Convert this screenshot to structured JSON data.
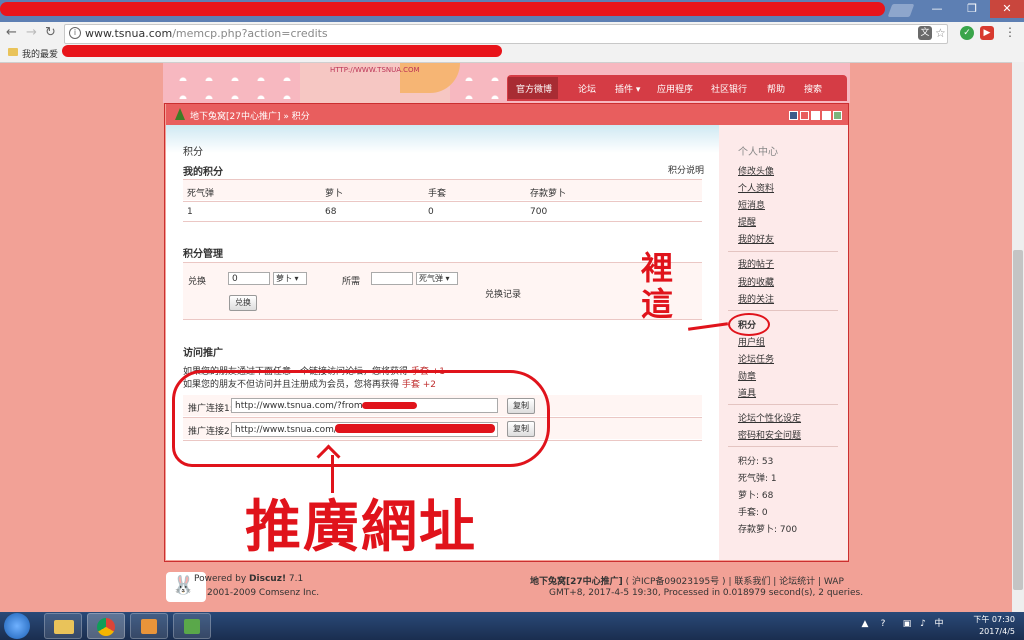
{
  "browser": {
    "url_host": "www.tsnua.com",
    "url_path": "/memcp.php?action=credits",
    "bookmark_folder": "我的最爱"
  },
  "banner": {
    "watermark_url": "HTTP://WWW.TSNUA.COM",
    "nav": [
      "官方微博",
      "论坛",
      "插件",
      "应用程序",
      "社区银行",
      "帮助",
      "搜索"
    ]
  },
  "breadcrumb": "地下兔窝[27中心推广] » 积分",
  "credits": {
    "page_title": "积分",
    "my_credits_heading": "我的积分",
    "explain_link": "积分说明",
    "columns": [
      "死气弹",
      "萝卜",
      "手套",
      "存款萝卜"
    ],
    "values": [
      "1",
      "68",
      "0",
      "700"
    ]
  },
  "manage": {
    "heading": "积分管理",
    "exchange_label": "兑换",
    "exchange_amount": "0",
    "exchange_unit": "萝卜",
    "required_label": "所需",
    "required_amount": "",
    "required_unit": "死气弹",
    "exchange_button": "兑换",
    "history_link": "兑换记录"
  },
  "promo": {
    "heading": "访问推广",
    "line1_text": "如果您的朋友通过下面任意一个链接访问论坛，您将获得",
    "line1_reward": "手套 +1",
    "line2_text": "如果您的朋友不但访问并且注册成为会员，您将再获得",
    "line2_reward": "手套 +2",
    "link1_label": "推广连接1:",
    "link1_value": "http://www.tsnua.com/?from",
    "link2_label": "推广连接2:",
    "link2_value": "http://www.tsnua.com/",
    "copy_button": "复制"
  },
  "sidebar": {
    "title": "个人中心",
    "group1": [
      "修改头像",
      "个人资料",
      "短消息",
      "提醒",
      "我的好友"
    ],
    "group2": [
      "我的帖子",
      "我的收藏",
      "我的关注"
    ],
    "group3": [
      "积分",
      "用户组",
      "论坛任务",
      "勋章",
      "道具"
    ],
    "group4": [
      "论坛个性化设定",
      "密码和安全问题"
    ],
    "stats": [
      "积分: 53",
      "死气弹: 1",
      "萝卜: 68",
      "手套: 0",
      "存款萝卜: 700"
    ]
  },
  "footer": {
    "powered": "Powered by",
    "product": "Discuz!",
    "version": "7.1",
    "copyright": "2001-2009 Comsenz Inc.",
    "site_name": "地下兔窝[27中心推广]",
    "icp": "( 沪ICP备09023195号 )",
    "contact": "| 联系我们",
    "stats": "| 论坛统计",
    "wap": "| WAP",
    "timing": "GMT+8, 2017-4-5 19:30, Processed in 0.018979 second(s), 2 queries."
  },
  "taskbar": {
    "clock_time": "下午 07:30",
    "clock_date": "2017/4/5"
  },
  "annotations": {
    "bottom_text": "推廣網址",
    "side_text": [
      "裡",
      "這"
    ]
  }
}
